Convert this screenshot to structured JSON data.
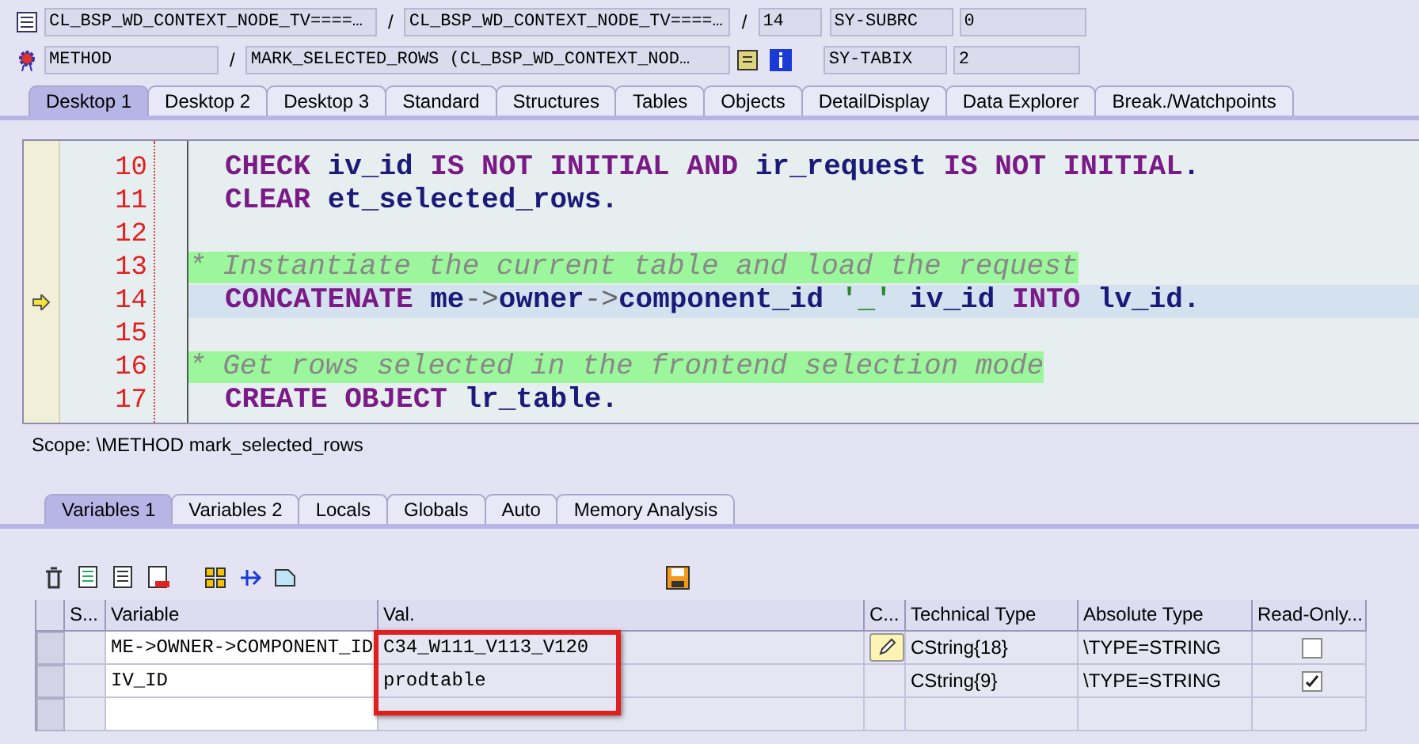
{
  "header": {
    "rows": [
      {
        "field_1": "CL_BSP_WD_CONTEXT_NODE_TV====…",
        "separator_1": "/",
        "field_2": "CL_BSP_WD_CONTEXT_NODE_TV====…",
        "separator_2": "/",
        "field_3": "14",
        "sy_name": "SY-SUBRC",
        "sy_value": "0"
      },
      {
        "field_1": "METHOD",
        "separator_1": "/",
        "field_2": "MARK_SELECTED_ROWS (CL_BSP_WD_CONTEXT_NOD…",
        "sy_name": "SY-TABIX",
        "sy_value": "2"
      }
    ]
  },
  "desktop_tabs": [
    {
      "label": "Desktop 1",
      "selected": true
    },
    {
      "label": "Desktop 2",
      "selected": false
    },
    {
      "label": "Desktop 3",
      "selected": false
    },
    {
      "label": "Standard",
      "selected": false
    },
    {
      "label": "Structures",
      "selected": false
    },
    {
      "label": "Tables",
      "selected": false
    },
    {
      "label": "Objects",
      "selected": false
    },
    {
      "label": "DetailDisplay",
      "selected": false
    },
    {
      "label": "Data Explorer",
      "selected": false
    },
    {
      "label": "Break./Watchpoints",
      "selected": false
    }
  ],
  "code": [
    {
      "number": "10",
      "current": false,
      "kind": "code",
      "tokens": [
        {
          "kind": "kw",
          "text": "CHECK "
        },
        {
          "kind": "id",
          "text": "iv_id "
        },
        {
          "kind": "kw",
          "text": "IS NOT INITIAL AND "
        },
        {
          "kind": "id",
          "text": "ir_request "
        },
        {
          "kind": "kw",
          "text": "IS NOT INITIAL"
        },
        {
          "kind": "op",
          "text": "."
        }
      ]
    },
    {
      "number": "11",
      "current": false,
      "kind": "code",
      "tokens": [
        {
          "kind": "kw",
          "text": "CLEAR "
        },
        {
          "kind": "id",
          "text": "et_selected_rows"
        },
        {
          "kind": "op",
          "text": "."
        }
      ]
    },
    {
      "number": "12",
      "current": false,
      "kind": "blank"
    },
    {
      "number": "13",
      "current": false,
      "kind": "comment",
      "tokens": [
        {
          "kind": "comment",
          "text": "* Instantiate the current table and load the request"
        }
      ]
    },
    {
      "number": "14",
      "current": true,
      "kind": "code",
      "tokens": [
        {
          "kind": "kw",
          "text": "CONCATENATE "
        },
        {
          "kind": "id",
          "text": "me"
        },
        {
          "kind": "arrow",
          "text": "->"
        },
        {
          "kind": "id",
          "text": "owner"
        },
        {
          "kind": "arrow",
          "text": "->"
        },
        {
          "kind": "id",
          "text": "component_id "
        },
        {
          "kind": "str",
          "text": "'_'"
        },
        {
          "kind": "id",
          "text": " iv_id "
        },
        {
          "kind": "kw",
          "text": "INTO "
        },
        {
          "kind": "id",
          "text": "lv_id"
        },
        {
          "kind": "op",
          "text": "."
        }
      ]
    },
    {
      "number": "15",
      "current": false,
      "kind": "blank"
    },
    {
      "number": "16",
      "current": false,
      "kind": "comment",
      "tokens": [
        {
          "kind": "comment",
          "text": "* Get rows selected in the frontend selection mode"
        }
      ]
    },
    {
      "number": "17",
      "current": false,
      "kind": "code",
      "tokens": [
        {
          "kind": "kw",
          "text": "CREATE OBJECT "
        },
        {
          "kind": "id",
          "text": "lr_table"
        },
        {
          "kind": "op",
          "text": "."
        }
      ]
    }
  ],
  "scope": "Scope: \\METHOD mark_selected_rows",
  "variable_tabs": [
    {
      "label": "Variables 1",
      "selected": true
    },
    {
      "label": "Variables 2",
      "selected": false
    },
    {
      "label": "Locals",
      "selected": false
    },
    {
      "label": "Globals",
      "selected": false
    },
    {
      "label": "Auto",
      "selected": false
    },
    {
      "label": "Memory Analysis",
      "selected": false
    }
  ],
  "table": {
    "columns": [
      "S...",
      "Variable",
      "Val.",
      "C...",
      "Technical Type",
      "Absolute Type",
      "Read-Only..."
    ],
    "value_highlight": true,
    "rows": [
      {
        "variable": "ME->OWNER->COMPONENT_ID",
        "value": "C34_W111_V113_V120",
        "editable": true,
        "technical_type": "CString{18}",
        "absolute_type": "\\TYPE=STRING",
        "read_only": false
      },
      {
        "variable": "IV_ID",
        "value": "prodtable",
        "editable": false,
        "technical_type": "CString{9}",
        "absolute_type": "\\TYPE=STRING",
        "read_only": true
      }
    ]
  }
}
